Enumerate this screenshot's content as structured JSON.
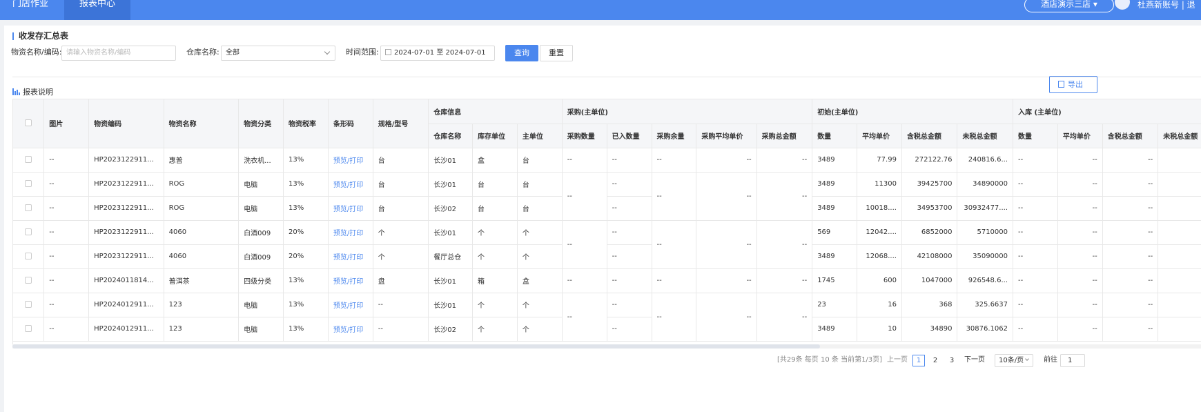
{
  "topbar": {
    "nav_store": "门店作业",
    "nav_report": "报表中心",
    "store_selector": "酒店演示三店",
    "user": "杜燕新账号 | 退"
  },
  "page": {
    "title": "收发存汇总表"
  },
  "filters": {
    "material_label": "物资名称/编码:",
    "material_placeholder": "请输入物资名称/编码",
    "warehouse_label": "仓库名称:",
    "warehouse_value": "全部",
    "time_label": "时间范围:",
    "date_start": "2024-07-01",
    "date_sep": "至",
    "date_end": "2024-07-01",
    "query_button": "查询",
    "reset_button": "重置"
  },
  "toolbar": {
    "report_note": "报表说明",
    "export_button": "导出"
  },
  "table": {
    "group_headers": {
      "warehouse": "仓库信息",
      "purchase": "采购(主单位)",
      "initial": "初始(主单位)",
      "inbound": "入库 (主单位)"
    },
    "columns": {
      "image": "图片",
      "code": "物资编码",
      "name": "物资名称",
      "category": "物资分类",
      "tax_rate": "物资税率",
      "barcode": "条形码",
      "spec": "规格/型号",
      "wh_name": "仓库名称",
      "stock_unit": "库存单位",
      "main_unit": "主单位",
      "p_qty": "采购数量",
      "p_in": "已入数量",
      "p_left": "采购余量",
      "p_avg": "采购平均单价",
      "p_total": "采购总金额",
      "i_qty": "数量",
      "i_avg": "平均单价",
      "i_tax": "含税总金额",
      "i_notax": "未税总金额",
      "in_qty": "数量",
      "in_avg": "平均单价",
      "in_tax": "含税总金额",
      "in_notax": "未税总金额"
    },
    "rows": [
      {
        "image": "--",
        "code": "HP2023122911...",
        "name": "惠普",
        "category": "洗衣机...",
        "tax": "13%",
        "barcode": "预览/打印",
        "spec": "台",
        "wh": "长沙01",
        "su": "盒",
        "mu": "台",
        "p_qty": "--",
        "p_in": "--",
        "p_left": "--",
        "p_avg": "--",
        "p_total": "--",
        "i_qty": "3489",
        "i_avg": "77.99",
        "i_tax": "272122.76",
        "i_notax": "240816.6...",
        "in_qty": "--",
        "in_avg": "--",
        "in_tax": "--",
        "in_notax": "--"
      },
      {
        "image": "--",
        "code": "HP2023122911...",
        "name": "ROG",
        "category": "电脑",
        "tax": "13%",
        "barcode": "预览/打印",
        "spec": "台",
        "wh": "长沙01",
        "su": "台",
        "mu": "台",
        "p_qty": "--",
        "p_in": "--",
        "p_left": "--",
        "p_avg": "--",
        "p_total": "--",
        "i_qty": "3489",
        "i_avg": "11300",
        "i_tax": "39425700",
        "i_notax": "34890000",
        "in_qty": "--",
        "in_avg": "--",
        "in_tax": "--",
        "in_notax": "--"
      },
      {
        "image": "--",
        "code": "HP2023122911...",
        "name": "ROG",
        "category": "电脑",
        "tax": "13%",
        "barcode": "预览/打印",
        "spec": "台",
        "wh": "长沙02",
        "su": "台",
        "mu": "台",
        "p_in": "--",
        "i_qty": "3489",
        "i_avg": "10018....",
        "i_tax": "34953700",
        "i_notax": "30932477....",
        "in_qty": "--",
        "in_avg": "--",
        "in_tax": "--",
        "in_notax": "--"
      },
      {
        "image": "--",
        "code": "HP2023122911...",
        "name": "4060",
        "category": "白酒009",
        "tax": "20%",
        "barcode": "预览/打印",
        "spec": "个",
        "wh": "长沙01",
        "su": "个",
        "mu": "个",
        "p_qty": "--",
        "p_in": "--",
        "p_left": "--",
        "p_avg": "--",
        "p_total": "--",
        "i_qty": "569",
        "i_avg": "12042....",
        "i_tax": "6852000",
        "i_notax": "5710000",
        "in_qty": "--",
        "in_avg": "--",
        "in_tax": "--",
        "in_notax": "--"
      },
      {
        "image": "--",
        "code": "HP2023122911...",
        "name": "4060",
        "category": "白酒009",
        "tax": "20%",
        "barcode": "预览/打印",
        "spec": "个",
        "wh": "餐厅总仓",
        "su": "个",
        "mu": "个",
        "p_in": "--",
        "i_qty": "3489",
        "i_avg": "12068....",
        "i_tax": "42108000",
        "i_notax": "35090000",
        "in_qty": "--",
        "in_avg": "--",
        "in_tax": "--",
        "in_notax": "--"
      },
      {
        "image": "--",
        "code": "HP2024011814...",
        "name": "普洱茶",
        "category": "四级分类",
        "tax": "13%",
        "barcode": "预览/打印",
        "spec": "盘",
        "wh": "长沙01",
        "su": "箱",
        "mu": "盒",
        "p_qty": "--",
        "p_in": "--",
        "p_left": "--",
        "p_avg": "--",
        "p_total": "--",
        "i_qty": "1745",
        "i_avg": "600",
        "i_tax": "1047000",
        "i_notax": "926548.6...",
        "in_qty": "--",
        "in_avg": "--",
        "in_tax": "--",
        "in_notax": "--"
      },
      {
        "image": "--",
        "code": "HP2024012911...",
        "name": "123",
        "category": "电脑",
        "tax": "13%",
        "barcode": "预览/打印",
        "spec": "--",
        "wh": "长沙01",
        "su": "个",
        "mu": "个",
        "p_qty": "--",
        "p_in": "--",
        "p_left": "--",
        "p_avg": "--",
        "p_total": "--",
        "i_qty": "23",
        "i_avg": "16",
        "i_tax": "368",
        "i_notax": "325.6637",
        "in_qty": "--",
        "in_avg": "--",
        "in_tax": "--",
        "in_notax": "--"
      },
      {
        "image": "--",
        "code": "HP2024012911...",
        "name": "123",
        "category": "电脑",
        "tax": "13%",
        "barcode": "预览/打印",
        "spec": "--",
        "wh": "长沙02",
        "su": "个",
        "mu": "个",
        "p_in": "--",
        "i_qty": "3489",
        "i_avg": "10",
        "i_tax": "34890",
        "i_notax": "30876.1062",
        "in_qty": "--",
        "in_avg": "--",
        "in_tax": "--",
        "in_notax": "--"
      }
    ]
  },
  "pagination": {
    "summary": "[共29条 每页 10 条 当前第1/3页]",
    "prev": "上一页",
    "pages": [
      "1",
      "2",
      "3"
    ],
    "next": "下一页",
    "page_size": "10条/页",
    "goto_label": "前往",
    "goto_value": "1"
  },
  "colors": {
    "primary": "#4b87ee",
    "topbar": "#4b87ee",
    "border": "#e8e8e8",
    "header_bg": "#f5f6f8"
  },
  "icons": [
    "chevron-down-icon",
    "calendar-icon",
    "bar-chart-icon",
    "export-icon",
    "avatar-icon"
  ]
}
